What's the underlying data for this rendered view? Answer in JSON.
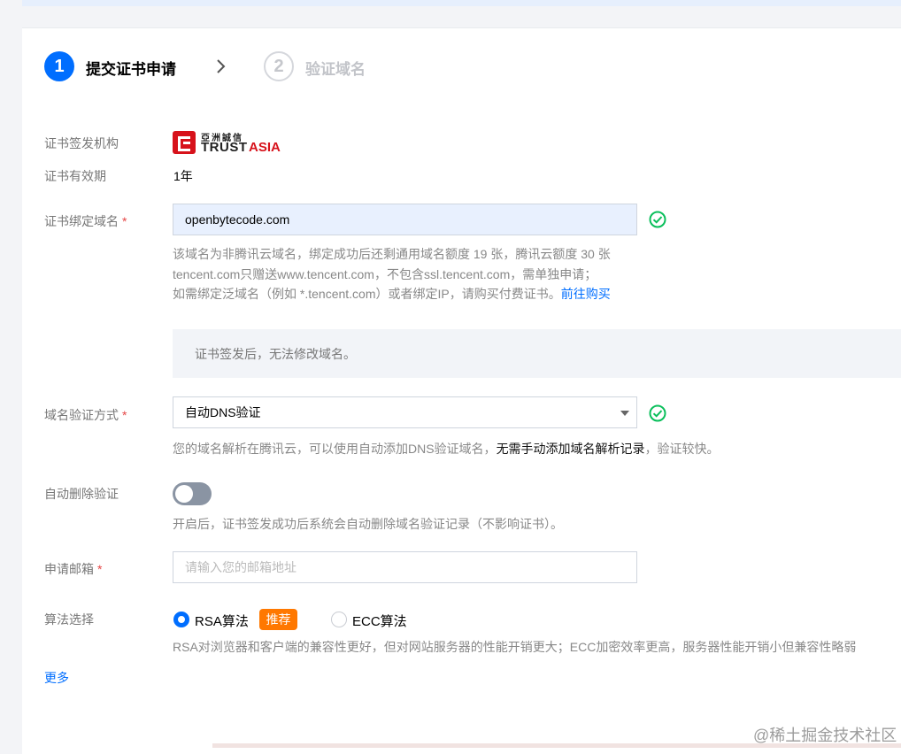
{
  "steps": [
    {
      "number": "1",
      "label": "提交证书申请"
    },
    {
      "number": "2",
      "label": "验证域名"
    }
  ],
  "issuer": {
    "label": "证书签发机构",
    "logo_cn": "亞洲誠信",
    "logo_en_1": "TRUST",
    "logo_en_2": "ASIA"
  },
  "validity": {
    "label": "证书有效期",
    "value": "1年"
  },
  "domain": {
    "label": "证书绑定域名",
    "required_mark": "*",
    "value": "openbytecode.com",
    "hint_1": "该域名为非腾讯云域名，绑定成功后还剩通用域名额度 19 张，腾讯云额度 30 张",
    "hint_2": "tencent.com只赠送www.tencent.com，不包含ssl.tencent.com，需单独申请；",
    "hint_3": "如需绑定泛域名（例如 *.tencent.com）或者绑定IP，请购买付费证书。",
    "hint_link": "前往购买",
    "notice": "证书签发后，无法修改域名。"
  },
  "verify_method": {
    "label": "域名验证方式",
    "required_mark": "*",
    "value": "自动DNS验证",
    "hint_a": "您的域名解析在腾讯云，可以使用自动添加DNS验证域名，",
    "hint_b": "无需手动添加域名解析记录",
    "hint_c": "，验证较快。"
  },
  "auto_delete": {
    "label": "自动删除验证",
    "enabled": false,
    "hint": "开启后，证书签发成功后系统会自动删除域名验证记录（不影响证书）。"
  },
  "email": {
    "label": "申请邮箱",
    "required_mark": "*",
    "placeholder": "请输入您的邮箱地址",
    "value": ""
  },
  "algorithm": {
    "label": "算法选择",
    "options": [
      {
        "label": "RSA算法",
        "selected": true,
        "badge": "推荐"
      },
      {
        "label": "ECC算法",
        "selected": false
      }
    ],
    "hint": "RSA对浏览器和客户端的兼容性更好，但对网站服务器的性能开销更大；ECC加密效率更高，服务器性能开销小但兼容性略弱"
  },
  "more_link": "更多",
  "watermark": "@稀土掘金技术社区",
  "colors": {
    "primary": "#006eff",
    "success": "#0abf5b",
    "badge": "#ff7800",
    "required": "#e54545"
  }
}
